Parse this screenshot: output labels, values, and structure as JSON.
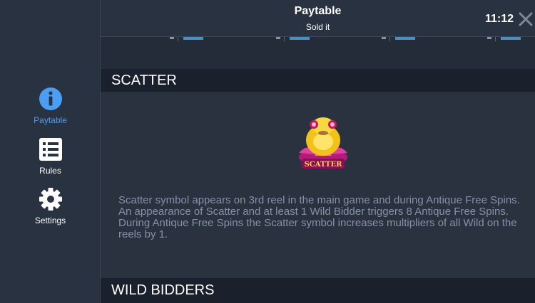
{
  "sidebar": {
    "items": [
      {
        "label": "Paytable",
        "icon": "info-icon",
        "active": true
      },
      {
        "label": "Rules",
        "icon": "list-icon",
        "active": false
      },
      {
        "label": "Settings",
        "icon": "gear-icon",
        "active": false
      }
    ]
  },
  "header": {
    "title": "Paytable",
    "subtitle": "Sold it",
    "clock": "11:12"
  },
  "sections": {
    "scatter": {
      "title": "SCATTER",
      "symbol_label": "SCATTER",
      "description": [
        "Scatter symbol appears on 3rd reel in the main game and during Antique Free Spins.",
        "An appearance of Scatter and at least 1 Wild Bidder triggers 8 Antique Free Spins.",
        "During Antique Free Spins the Scatter symbol increases multipliers of all Wild on the reels by 1."
      ]
    },
    "wild_bidders": {
      "title": "WILD BIDDERS"
    }
  },
  "colors": {
    "accent": "#4a9ff5",
    "panel": "#2a3240",
    "section_header": "#1a212c",
    "text_muted": "#8591a6"
  }
}
